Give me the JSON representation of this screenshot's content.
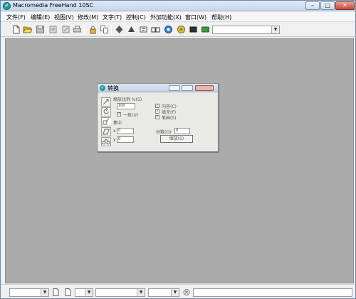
{
  "window": {
    "title": "Macromedia FreeHand 10SC",
    "controls": {
      "minimize": "–",
      "maximize": "□",
      "close": "✕"
    }
  },
  "menu": [
    {
      "label": "文件(F)"
    },
    {
      "label": "编辑(E)"
    },
    {
      "label": "视图(V)"
    },
    {
      "label": "修改(M)"
    },
    {
      "label": "文字(T)"
    },
    {
      "label": "控制(C)"
    },
    {
      "label": "外加功能(X)"
    },
    {
      "label": "窗口(W)"
    },
    {
      "label": "帮助(H)"
    }
  ],
  "toolbar": {
    "buttons": [
      "new-document",
      "open-file",
      "save",
      "import",
      "export",
      "print",
      "print-setup",
      "lock",
      "copy",
      "align",
      "symbols",
      "text-edit",
      "library",
      "magic",
      "color-mixer",
      "swatches",
      "layer"
    ],
    "select_value": ""
  },
  "panel": {
    "title": "转换",
    "icon_letter": "✐",
    "scale_label": "缩放比例 %(S)",
    "scale_value": "100",
    "uniform_label": "一致(U)",
    "center_label": "集中",
    "x_label": "x",
    "x_value": "0",
    "y_label": "y",
    "y_value": "0",
    "contents_label": "内容(C)",
    "fills_label": "填充(F)",
    "strokes_label": "笔画(S)",
    "copies_label": "份数(O)",
    "copies_value": "0",
    "apply_label": "缩放(S)"
  },
  "statusbar": {
    "zoom_value": "",
    "page_value": "",
    "view_mode_value": "",
    "units_value": "",
    "readout_value": ""
  },
  "colors": {
    "workspace": "#ababab",
    "titlebar": "#c7d6ea",
    "accent": "#1a9ea0"
  }
}
